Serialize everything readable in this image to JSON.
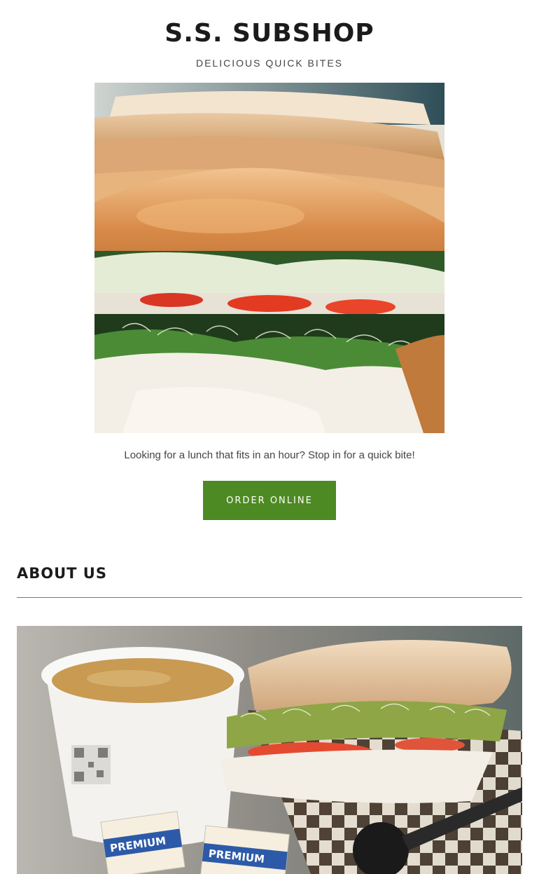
{
  "site": {
    "title": "S.S. SUBSHOP",
    "tagline": "DELICIOUS QUICK BITES"
  },
  "hero": {
    "image_desc": "sub-sandwiches-photo",
    "intro_text": "Looking for a lunch that fits in an hour? Stop in for a quick bite!",
    "cta_label": "ORDER ONLINE"
  },
  "about": {
    "heading": "ABOUT US",
    "image_desc": "soup-and-sandwich-photo",
    "cracker_text": "PREMIUM"
  },
  "colors": {
    "accent": "#4e8a23",
    "text": "#1b1b1b",
    "divider": "#777777"
  }
}
